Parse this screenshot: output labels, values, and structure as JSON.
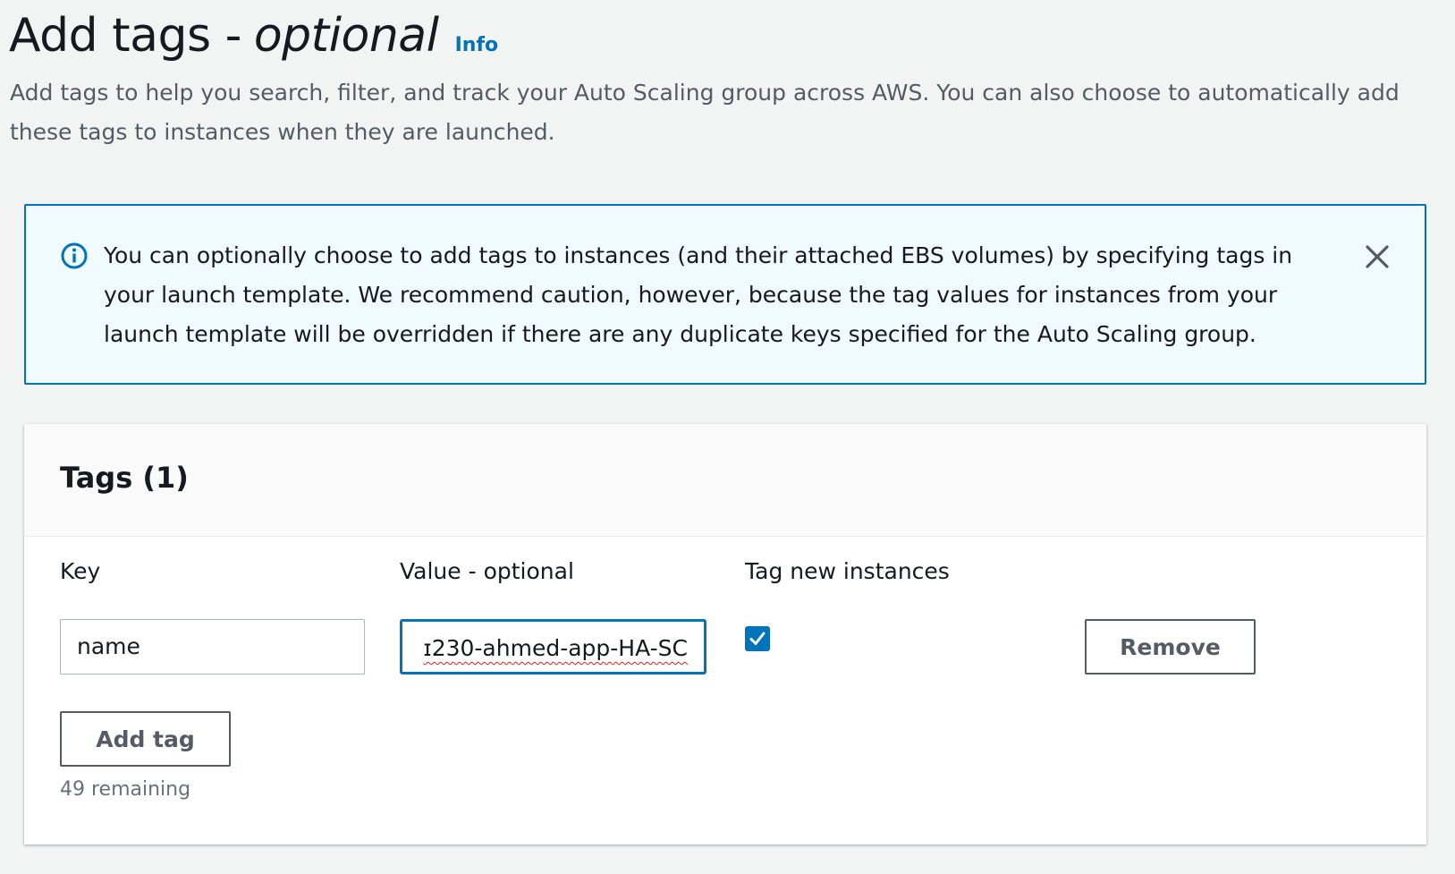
{
  "header": {
    "title": "Add tags -",
    "title_optional": "optional",
    "info_link": "Info",
    "description": "Add tags to help you search, filter, and track your Auto Scaling group across AWS. You can also choose to automatically add these tags to instances when they are launched."
  },
  "alert": {
    "icon": "info-circle-icon",
    "text": "You can optionally choose to add tags to instances (and their attached EBS volumes) by specifying tags in your launch template. We recommend caution, however, because the tag values for instances from your launch template will be overridden if there are any duplicate keys specified for the Auto Scaling group.",
    "close_icon": "close-icon"
  },
  "tags_panel": {
    "title": "Tags (1)",
    "columns": {
      "key": "Key",
      "value": "Value - optional",
      "tag_new_instances": "Tag new instances"
    },
    "rows": [
      {
        "key": "name",
        "value_visible": "ɪ230-ahmed-app-HA-SC",
        "tag_new_instances": true,
        "remove_label": "Remove"
      }
    ],
    "add_tag_label": "Add tag",
    "remaining_text": "49 remaining"
  },
  "colors": {
    "accent": "#0073bb",
    "page_bg": "#f2f3f3",
    "alert_bg": "#f1faff",
    "secondary_text": "#545b64"
  }
}
